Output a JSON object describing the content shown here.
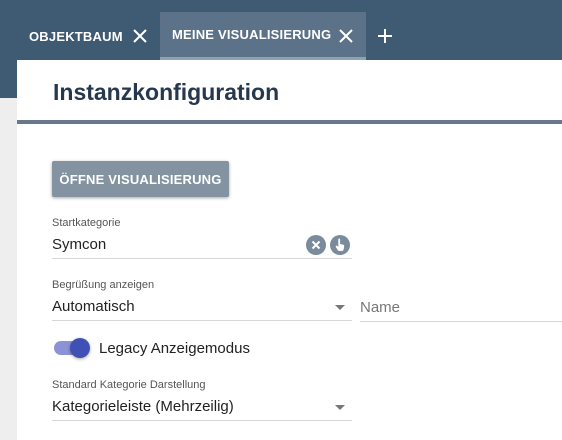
{
  "tabs": [
    {
      "label": "OBJEKTBAUM",
      "active": false
    },
    {
      "label": "MEINE VISUALISIERUNG",
      "active": true
    }
  ],
  "panel": {
    "title": "Instanzkonfiguration",
    "open_button_label": "ÖFFNE VISUALISIERUNG",
    "start_category": {
      "label": "Startkategorie",
      "value": "Symcon"
    },
    "greeting": {
      "label": "Begrüßung anzeigen",
      "value": "Automatisch"
    },
    "name_field": {
      "placeholder": "Name",
      "value": ""
    },
    "legacy_toggle": {
      "label": "Legacy Anzeigemodus",
      "on": true
    },
    "category_display": {
      "label": "Standard Kategorie Darstellung",
      "value": "Kategorieleiste (Mehrzeilig)"
    }
  },
  "icons": {
    "tab_close": "close-icon",
    "add_tab": "plus-icon",
    "clear": "clear-circle-icon",
    "select": "hand-pointer-icon",
    "dropdown": "chevron-down-icon"
  },
  "colors": {
    "topbar": "#3f5a73",
    "active_tab": "#5b7288",
    "accent": "#3f51b5",
    "button": "#8393a1",
    "title": "#26384d"
  }
}
